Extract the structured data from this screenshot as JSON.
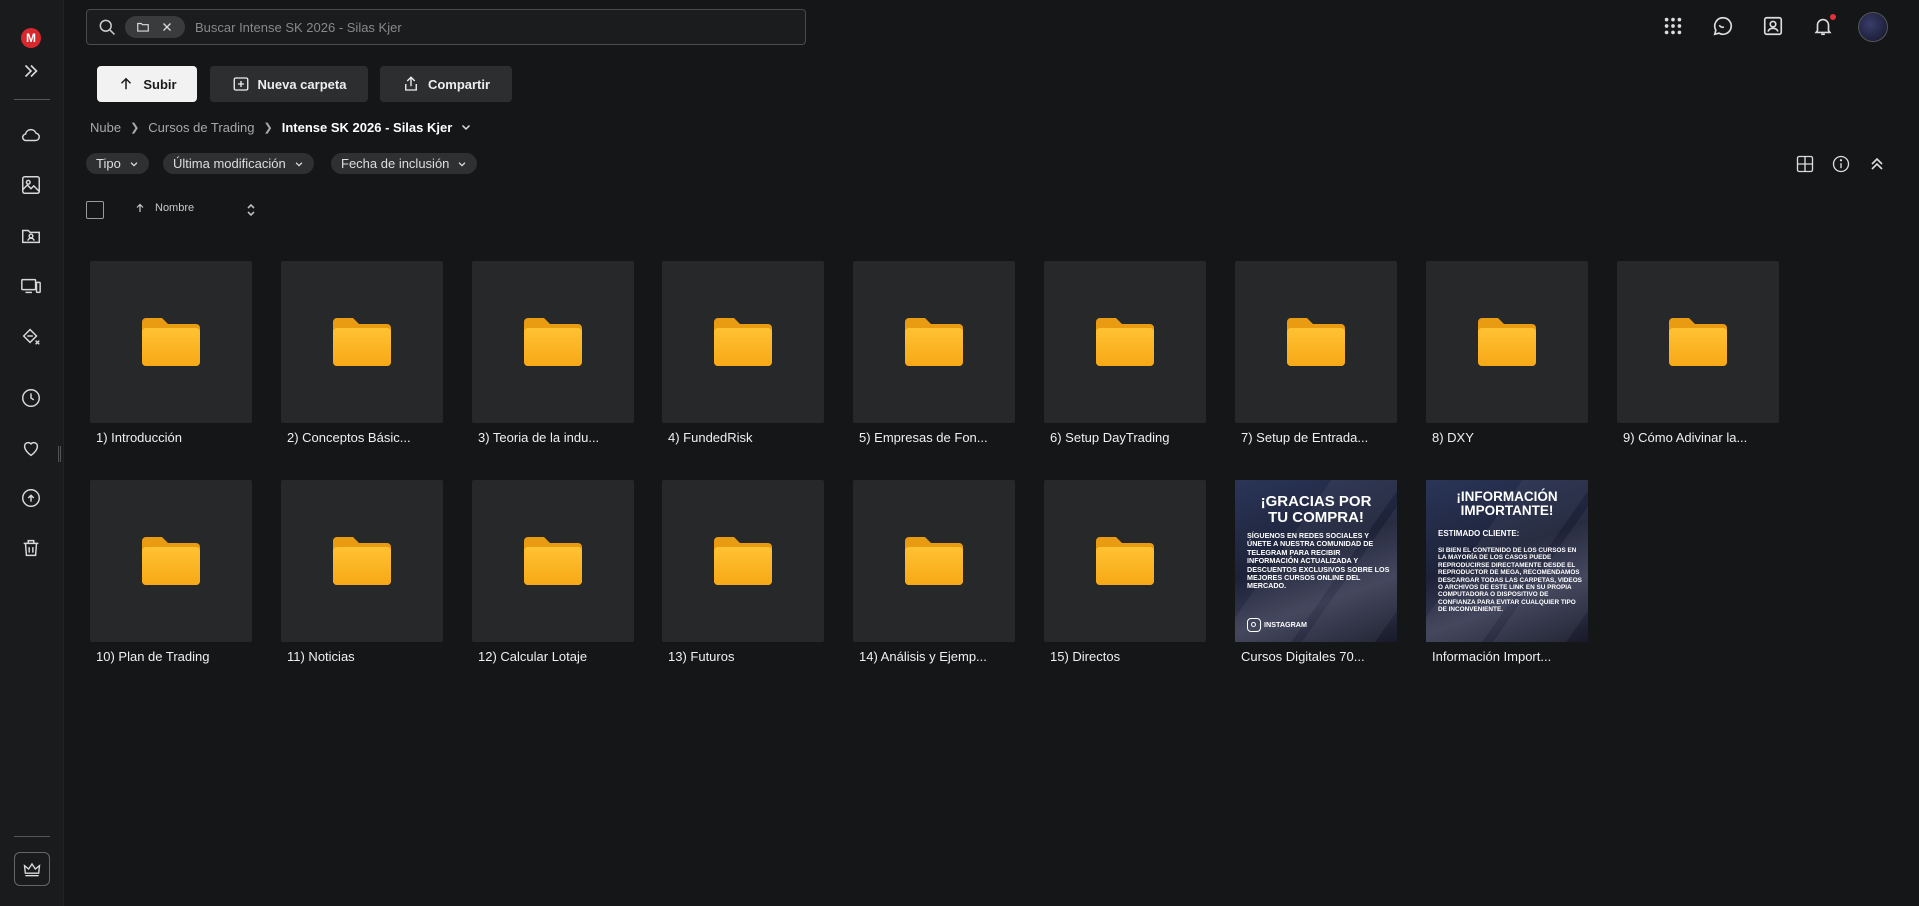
{
  "app": {
    "logo_letter": "M"
  },
  "search": {
    "placeholder": "Buscar Intense SK 2026 - Silas Kjer"
  },
  "actions": {
    "upload": "Subir",
    "new_folder": "Nueva carpeta",
    "share": "Compartir"
  },
  "breadcrumb": {
    "items": [
      "Nube",
      "Cursos de Trading"
    ],
    "current": "Intense SK 2026 - Silas Kjer"
  },
  "filters": [
    "Tipo",
    "Última modificación",
    "Fecha de inclusión"
  ],
  "sort": {
    "column": "Nombre"
  },
  "folders": [
    "1) Introducción",
    "2) Conceptos Básic...",
    "3) Teoria de la indu...",
    "4) FundedRisk",
    "5) Empresas de Fon...",
    "6) Setup DayTrading",
    "7) Setup de Entrada...",
    "8) DXY",
    "9) Cómo Adivinar la...",
    "10) Plan de Trading",
    "11) Noticias",
    "12) Calcular Lotaje",
    "13) Futuros",
    "14) Análisis y Ejemp...",
    "15) Directos"
  ],
  "images": [
    {
      "label": "Cursos Digitales 70...",
      "heading": "¡GRACIAS POR TU COMPRA!",
      "body": "SÍGUENOS EN REDES SOCIALES Y ÚNETE A NUESTRA COMUNIDAD DE TELEGRAM PARA RECIBIR INFORMACIÓN ACTUALIZADA Y DESCUENTOS EXCLUSIVOS SOBRE LOS MEJORES CURSOS ONLINE DEL MERCADO.",
      "footer": "INSTAGRAM"
    },
    {
      "label": "Información Import...",
      "heading": "¡INFORMACIÓN IMPORTANTE!",
      "subheading": "ESTIMADO CLIENTE:",
      "body": "SI BIEN EL CONTENIDO DE LOS CURSOS EN LA MAYORÍA DE LOS CASOS PUEDE REPRODUCIRSE DIRECTAMENTE DESDE EL REPRODUCTOR DE MEGA, RECOMENDAMOS DESCARGAR TODAS LAS CARPETAS, VIDEOS O ARCHIVOS DE ESTE LINK EN SU PROPIA COMPUTADORA O DISPOSITIVO DE CONFIANZA PARA EVITAR CUALQUIER TIPO DE INCONVENIENTE."
    }
  ],
  "colors": {
    "accent": "#d9272e",
    "folder": "#fbb41e",
    "background": "#151617",
    "tile": "#27282a"
  }
}
